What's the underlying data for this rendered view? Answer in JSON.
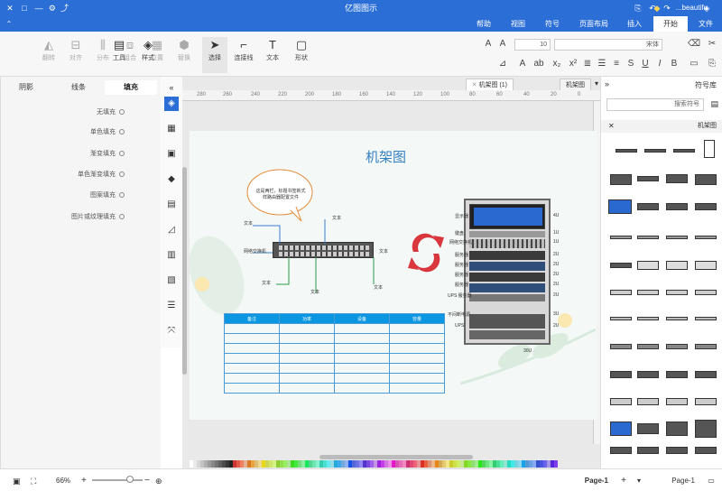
{
  "titlebar": {
    "title": "亿图图示",
    "doc_name": "beautifu...",
    "controls": [
      "—",
      "□",
      "✕"
    ]
  },
  "menu": {
    "items": [
      "文件",
      "开始",
      "插入",
      "页面布局",
      "符号",
      "视图",
      "帮助"
    ],
    "active": "开始"
  },
  "ribbon": {
    "font_name": "宋体",
    "font_size": "10",
    "buttons": [
      "选择",
      "连接线",
      "文本",
      "形状",
      "工具",
      "样式",
      "大小",
      "翻转",
      "对齐",
      "分布",
      "组合",
      "位置",
      "替换"
    ]
  },
  "right_panel": {
    "tabs": [
      "填充",
      "线条",
      "阴影"
    ],
    "active_tab": "填充",
    "options": [
      "无填充",
      "单色填充",
      "渐变填充",
      "单色渐变填充",
      "图案填充",
      "图片或纹理填充"
    ]
  },
  "doc_tabs": [
    "机架图",
    "机架图 (1)"
  ],
  "ruler": [
    "280",
    "260",
    "240",
    "220",
    "200",
    "180",
    "160",
    "140",
    "120",
    "100",
    "80",
    "60",
    "40",
    "20",
    "0"
  ],
  "diagram": {
    "title": "机架图",
    "bubble": "这是两栏，标题书签新式样路由器配置文件",
    "labels": {
      "text1": "文本",
      "text2": "文本",
      "text3": "文本",
      "text4": "文本",
      "text5": "文本",
      "text6": "文本",
      "switch": "网络交换机"
    },
    "rack_labels_left": [
      "显示器",
      "键盘",
      "网络交换机",
      "服务器",
      "服务器",
      "服务器",
      "服务器",
      "UPS 服务器",
      "不间断电源",
      "UPS"
    ],
    "rack_labels_right": [
      "4U",
      "1U",
      "1U",
      "2U",
      "2U",
      "2U",
      "2U",
      "2U",
      "3U",
      "2U"
    ],
    "rack_bottom": "30U",
    "table_headers": [
      "容量",
      "设备",
      "功率",
      "备注"
    ],
    "table_rows": 8
  },
  "library": {
    "header": "符号库",
    "search_placeholder": "搜索符号",
    "section": "机架图"
  },
  "status": {
    "page_name": "Page-1",
    "page_tab": "Page-1",
    "zoom": "66%",
    "add": "+"
  },
  "colors": {
    "accent": "#2b6fd6",
    "table_header": "#0a96e0",
    "refresh": "#d9363e"
  }
}
